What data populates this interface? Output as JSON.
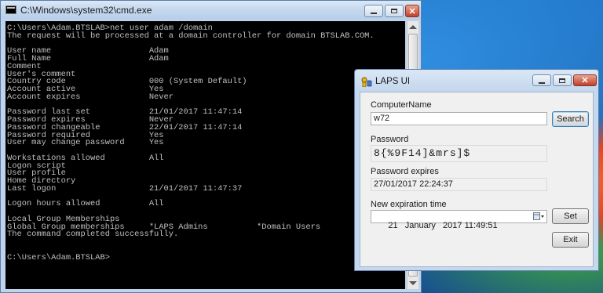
{
  "cmd": {
    "title": "C:\\Windows\\system32\\cmd.exe",
    "text": "C:\\Users\\Adam.BTSLAB>net user adam /domain\nThe request will be processed at a domain controller for domain BTSLAB.COM.\n\nUser name                    Adam\nFull Name                    Adam\nComment\nUser's comment\nCountry code                 000 (System Default)\nAccount active               Yes\nAccount expires              Never\n\nPassword last set            21/01/2017 11:47:14\nPassword expires             Never\nPassword changeable          22/01/2017 11:47:14\nPassword required            Yes\nUser may change password     Yes\n\nWorkstations allowed         All\nLogon script\nUser profile\nHome directory\nLast logon                   21/01/2017 11:47:37\n\nLogon hours allowed          All\n\nLocal Group Memberships\nGlobal Group memberships     *LAPS Admins          *Domain Users\nThe command completed successfully.\n\n\nC:\\Users\\Adam.BTSLAB>"
  },
  "laps": {
    "title": "LAPS UI",
    "computer_name_label": "ComputerName",
    "computer_name_value": "w72",
    "search_label": "Search",
    "password_label": "Password",
    "password_value": "8{%9F14]&mrs]$",
    "password_expires_label": "Password expires",
    "password_expires_value": "27/01/2017 22:24:37",
    "new_expiration_label": "New expiration time",
    "new_expiration_value": "21   January   2017 11:49:51",
    "set_label": "Set",
    "exit_label": "Exit"
  },
  "colors": {
    "console_bg": "#000000",
    "console_fg": "#c0c0c0",
    "title_bar": "#c4d7ee",
    "close_button": "#c0402a"
  },
  "icons": [
    "console-icon",
    "minimize-icon",
    "maximize-icon",
    "close-icon",
    "laps-key-icon",
    "calendar-icon"
  ]
}
